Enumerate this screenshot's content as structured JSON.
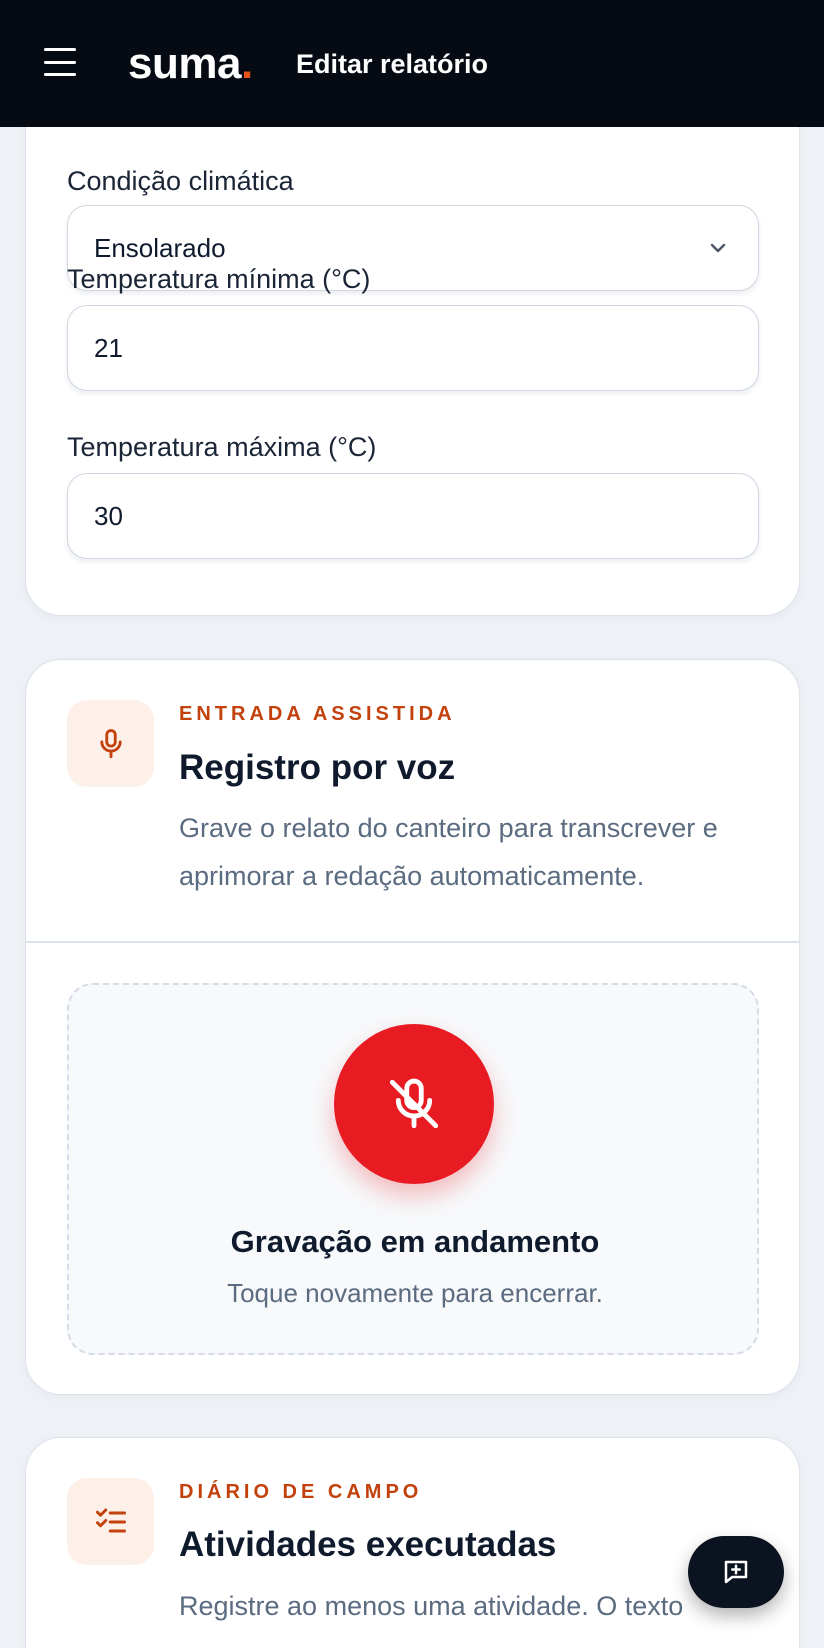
{
  "header": {
    "logo_text": "suma",
    "logo_dot": ".",
    "title": "Editar relatório"
  },
  "weather": {
    "condition_label": "Condição climática",
    "condition_value": "Ensolarado",
    "temp_min_label": "Temperatura mínima (°C)",
    "temp_min_value": "21",
    "temp_max_label": "Temperatura máxima (°C)",
    "temp_max_value": "30"
  },
  "voice": {
    "eyebrow": "ENTRADA ASSISTIDA",
    "title": "Registro por voz",
    "description": "Grave o relato do canteiro para transcrever e aprimorar a redação automaticamente.",
    "recording_title": "Gravação em andamento",
    "recording_hint": "Toque novamente para encerrar.",
    "record_button_color": "#e81b23"
  },
  "activities": {
    "eyebrow": "DIÁRIO DE CAMPO",
    "title": "Atividades executadas",
    "description": "Registre ao menos uma atividade. O texto"
  },
  "colors": {
    "accent": "#c2410c",
    "header_bg": "#060a12",
    "logo_dot": "#e5531a"
  },
  "icons": {
    "menu": "hamburger-menu-icon",
    "select": "chevron-down-icon",
    "voice": "microphone-icon",
    "record": "microphone-off-icon",
    "activities": "checklist-icon",
    "fab": "message-plus-icon"
  }
}
